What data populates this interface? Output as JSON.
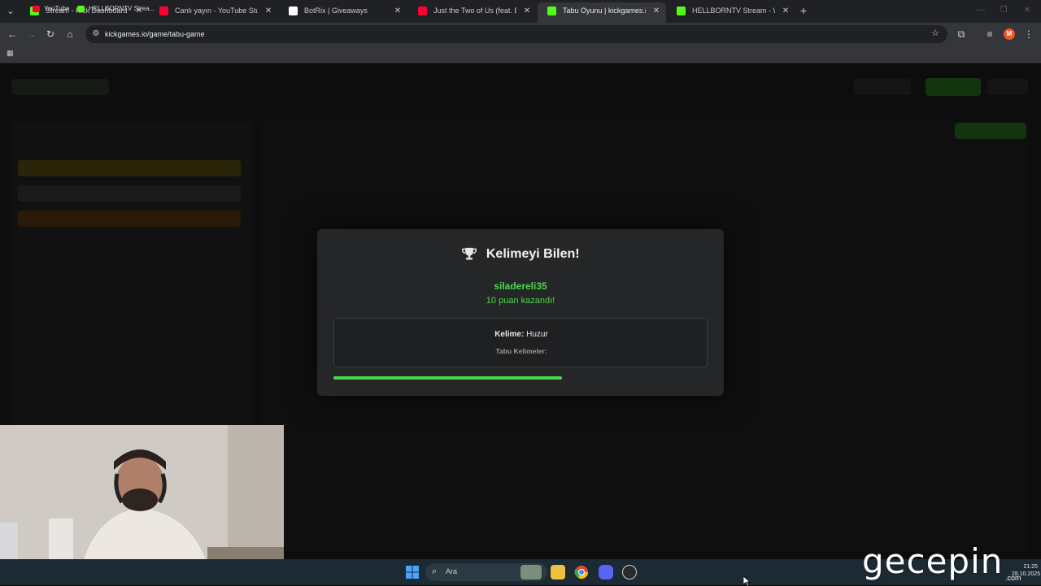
{
  "browser": {
    "tabs": [
      {
        "title": "Stream - Kick Dashboard",
        "favicon": "kick-icon",
        "color": "#53fc18",
        "active": false
      },
      {
        "title": "Canlı yayın - YouTube Studio",
        "favicon": "youtube-studio-icon",
        "color": "#ff0033",
        "active": false
      },
      {
        "title": "BotRix | Giveaways",
        "favicon": "botrix-icon",
        "color": "#ffffff",
        "active": false
      },
      {
        "title": "Just the Two of Us (feat. Bill Wi",
        "favicon": "youtube-icon",
        "color": "#ff0033",
        "active": false
      },
      {
        "title": "Tabu Oyunu | kickgames.io",
        "favicon": "kickgames-icon",
        "color": "#53fc18",
        "active": true
      },
      {
        "title": "HELLBORNTV Stream - Watch L",
        "favicon": "kick-icon",
        "color": "#53fc18",
        "active": false
      }
    ],
    "url": "kickgames.io/game/tabu-game",
    "profile_initial": "M",
    "bookmarks": [
      {
        "label": "YouTube",
        "icon": "youtube-icon",
        "color": "#ff0033"
      },
      {
        "label": "HELLBORNTV Strea...",
        "icon": "kick-icon",
        "color": "#53fc18"
      }
    ]
  },
  "modal": {
    "title": "Kelimeyi Bilen!",
    "icon": "trophy-icon",
    "winner": "siladereli35",
    "points_text": "10 puan kazandı!",
    "word_label": "Kelime:",
    "word_value": "Huzur",
    "taboo_label": "Tabu Kelimeler:",
    "progress": 0.61,
    "accent_color": "#4dd64d"
  },
  "taskbar": {
    "search_placeholder": "Ara",
    "time": "21:25",
    "date": "28.10.2025"
  },
  "watermark": {
    "brand": "gecepin",
    "suffix": ".com"
  }
}
